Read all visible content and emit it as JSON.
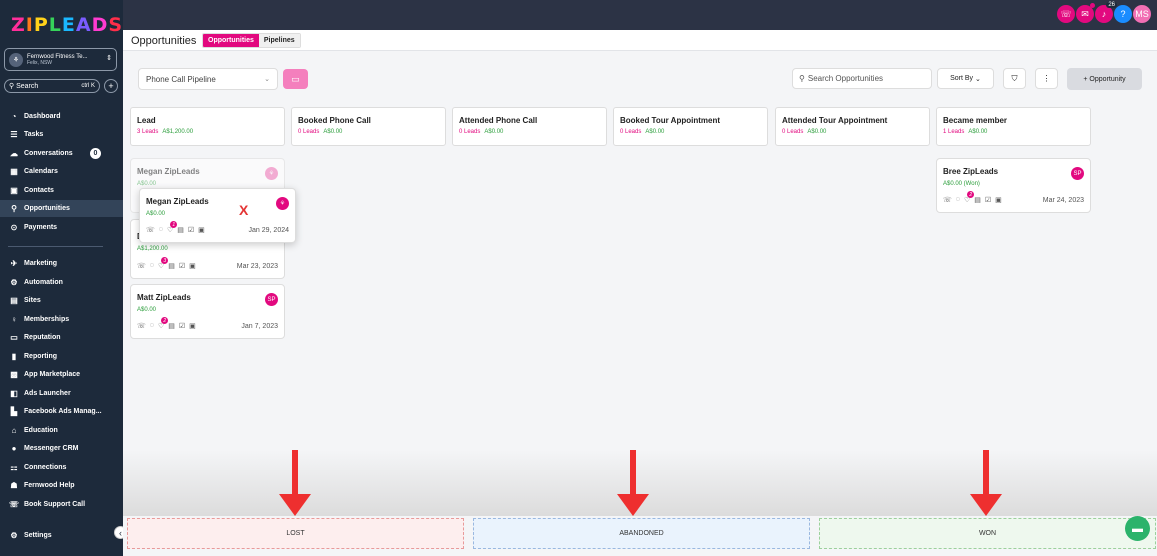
{
  "brand": {
    "letters": [
      "Z",
      "I",
      "P",
      "L",
      "E",
      "A",
      "D",
      "S"
    ],
    "colors": [
      "#ff2e9a",
      "#ff7a1a",
      "#ffd21a",
      "#36d35a",
      "#1ab8ff",
      "#7a5cff",
      "#ff3bd0",
      "#ff2e4a"
    ]
  },
  "sidebar": {
    "location": {
      "name": "Fernwood Fitness Te...",
      "sub": "Felix, NSW"
    },
    "search": {
      "label": "Search",
      "shortcut": "ctrl K"
    },
    "items": [
      {
        "label": "Dashboard",
        "icon": "dashboard-icon",
        "glyph": "◔"
      },
      {
        "label": "Tasks",
        "icon": "tasks-icon",
        "glyph": "☰"
      },
      {
        "label": "Conversations",
        "icon": "chat-icon",
        "glyph": "☁",
        "badge": "0"
      },
      {
        "label": "Calendars",
        "icon": "calendar-icon",
        "glyph": "▦"
      },
      {
        "label": "Contacts",
        "icon": "contacts-icon",
        "glyph": "▣"
      },
      {
        "label": "Opportunities",
        "icon": "opportunities-icon",
        "glyph": "⚲",
        "selected": true
      },
      {
        "label": "Payments",
        "icon": "payments-icon",
        "glyph": "⊙"
      },
      {
        "label": "Marketing",
        "icon": "marketing-icon",
        "glyph": "✈"
      },
      {
        "label": "Automation",
        "icon": "automation-icon",
        "glyph": "⚙"
      },
      {
        "label": "Sites",
        "icon": "sites-icon",
        "glyph": "▤"
      },
      {
        "label": "Memberships",
        "icon": "memberships-icon",
        "glyph": "♀"
      },
      {
        "label": "Reputation",
        "icon": "reputation-icon",
        "glyph": "▭"
      },
      {
        "label": "Reporting",
        "icon": "reporting-icon",
        "glyph": "▮"
      },
      {
        "label": "App Marketplace",
        "icon": "marketplace-icon",
        "glyph": "▩"
      },
      {
        "label": "Ads Launcher",
        "icon": "ads-icon",
        "glyph": "◧"
      },
      {
        "label": "Facebook Ads Manag...",
        "icon": "facebook-ads-icon",
        "glyph": "▙"
      },
      {
        "label": "Education",
        "icon": "education-icon",
        "glyph": "⌂"
      },
      {
        "label": "Messenger CRM",
        "icon": "messenger-icon",
        "glyph": "●"
      },
      {
        "label": "Connections",
        "icon": "connections-icon",
        "glyph": "⚏"
      },
      {
        "label": "Fernwood Help",
        "icon": "help-icon",
        "glyph": "☗"
      },
      {
        "label": "Book Support Call",
        "icon": "support-icon",
        "glyph": "☏"
      },
      {
        "label": "Settings",
        "icon": "settings-icon",
        "glyph": "⚙"
      }
    ]
  },
  "topbar": {
    "badge_count": "26",
    "avatar": "MS"
  },
  "page": {
    "title": "Opportunities",
    "tabs": [
      "Opportunities",
      "Pipelines"
    ]
  },
  "toolbar": {
    "pipeline": "Phone Call Pipeline",
    "search_placeholder": "Search Opportunities",
    "sort": "Sort By",
    "add": "Opportunity"
  },
  "columns": [
    {
      "name": "Lead",
      "count": "3 Leads",
      "amount": "A$1,200.00"
    },
    {
      "name": "Booked Phone Call",
      "count": "0 Leads",
      "amount": "A$0.00"
    },
    {
      "name": "Attended Phone Call",
      "count": "0 Leads",
      "amount": "A$0.00"
    },
    {
      "name": "Booked Tour Appointment",
      "count": "0 Leads",
      "amount": "A$0.00"
    },
    {
      "name": "Attended Tour Appointment",
      "count": "0 Leads",
      "amount": "A$0.00"
    },
    {
      "name": "Became member",
      "count": "1 Leads",
      "amount": "A$0.00"
    }
  ],
  "cards": {
    "ghost": {
      "name": "Megan ZipLeads",
      "amount": "A$0.00"
    },
    "dragging": {
      "name": "Megan ZipLeads",
      "amount": "A$0.00",
      "badge": "1",
      "date": "Jan 29, 2024"
    },
    "second": {
      "name": "D",
      "amount": "A$1,200.00",
      "badge": "3",
      "date": "Mar 23, 2023"
    },
    "matt": {
      "name": "Matt ZipLeads",
      "amount": "A$0.00",
      "avatar": "SP",
      "badge": "2",
      "date": "Jan 7, 2023"
    },
    "bree": {
      "name": "Bree ZipLeads",
      "amount": "A$0.00 (Won)",
      "avatar": "SP",
      "badge": "2",
      "date": "Mar 24, 2023"
    }
  },
  "annotation": {
    "x_mark": "X"
  },
  "drop_zones": {
    "lost": "LOST",
    "abandoned": "ABANDONED",
    "won": "WON"
  }
}
